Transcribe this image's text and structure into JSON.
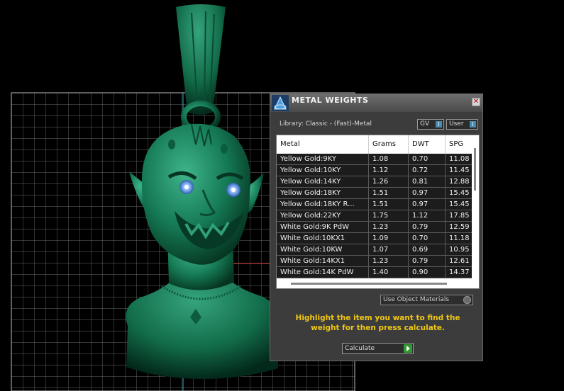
{
  "window": {
    "title": "METAL WEIGHTS",
    "close_glyph": "✕",
    "library_label": "Library: Classic - (Fast)-Metal",
    "toggles": [
      {
        "label": "GV",
        "indicator": "I"
      },
      {
        "label": "User",
        "indicator": "I"
      }
    ]
  },
  "table": {
    "columns": [
      "Metal",
      "Grams",
      "DWT",
      "SPG"
    ],
    "rows": [
      [
        "Yellow Gold:9KY",
        "1.08",
        "0.70",
        "11.08"
      ],
      [
        "Yellow Gold:10KY",
        "1.12",
        "0.72",
        "11.45"
      ],
      [
        "Yellow Gold:14KY",
        "1.26",
        "0.81",
        "12.88"
      ],
      [
        "Yellow Gold:18KY",
        "1.51",
        "0.97",
        "15.45"
      ],
      [
        "Yellow Gold:18KY R...",
        "1.51",
        "0.97",
        "15.45"
      ],
      [
        "Yellow Gold:22KY",
        "1.75",
        "1.12",
        "17.85"
      ],
      [
        "White Gold:9K PdW",
        "1.23",
        "0.79",
        "12.59"
      ],
      [
        "White Gold:10KX1",
        "1.09",
        "0.70",
        "11.18"
      ],
      [
        "White Gold:10KW",
        "1.07",
        "0.69",
        "10.95"
      ],
      [
        "White Gold:14KX1",
        "1.23",
        "0.79",
        "12.61"
      ],
      [
        "White Gold:14K PdW",
        "1.40",
        "0.90",
        "14.37"
      ]
    ]
  },
  "use_object_materials": {
    "label": "Use Object Materials"
  },
  "instruction": "Highlight the item you want to find the weight for then press calculate.",
  "calculate": {
    "label": "Calculate"
  },
  "colors": {
    "model_green": "#1a7a55",
    "instruction_yellow": "#f0c814",
    "panel_bg": "#3c3c3c",
    "grid_line": "#c8c8c8"
  },
  "icons": [
    "metal-weights-logo-icon",
    "close-icon",
    "play-arrow-icon"
  ]
}
